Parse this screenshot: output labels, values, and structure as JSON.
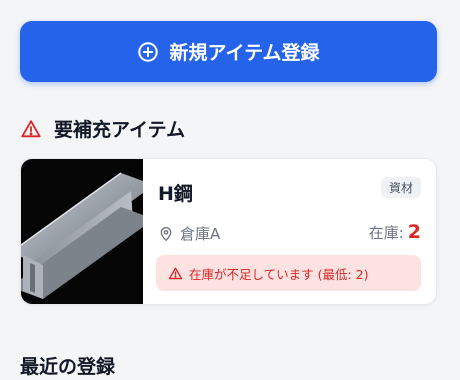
{
  "actions": {
    "register_label": "新規アイテム登録",
    "register_icon": "plus-circle-icon"
  },
  "restock_section": {
    "title": "要補充アイテム",
    "icon": "alert-triangle-icon",
    "accent_color": "#dc2626",
    "items": [
      {
        "name": "H鋼",
        "category": "資材",
        "location": "倉庫A",
        "location_icon": "map-pin-icon",
        "stock_label": "在庫:",
        "stock_value": "2",
        "alert_text": "在庫が不足しています (最低: 2)",
        "alert_icon": "alert-triangle-icon",
        "image": "h-beam-photo"
      }
    ]
  },
  "recent_section": {
    "title": "最近の登録"
  },
  "colors": {
    "primary": "#2563eb",
    "danger": "#dc2626",
    "alert_bg": "#fde2e2",
    "background": "#f4f5f7"
  }
}
